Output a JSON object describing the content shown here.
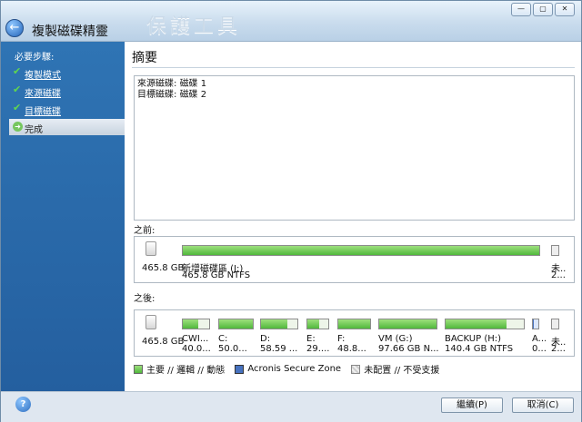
{
  "window": {
    "title": "複製磁碟精靈",
    "background_title": "保護工具",
    "controls": [
      "—",
      "▢",
      "✕"
    ]
  },
  "sidebar": {
    "heading": "必要步驟:",
    "steps": [
      {
        "label": "複製模式",
        "icon": "check-icon",
        "active": false
      },
      {
        "label": "來源磁碟",
        "icon": "check-icon",
        "active": false
      },
      {
        "label": "目標磁碟",
        "icon": "check-icon",
        "active": false
      },
      {
        "label": "完成",
        "icon": "arrow-right-icon",
        "active": true
      }
    ]
  },
  "summary": {
    "title": "摘要",
    "source_label": "來源磁碟:",
    "source_value": "磁碟 1",
    "target_label": "目標磁碟:",
    "target_value": "磁碟 2"
  },
  "before": {
    "label": "之前:",
    "disk_size": "465.8 GB",
    "partitions": [
      {
        "name": "新增磁碟區 (J:)",
        "detail": "465.8 GB  NTFS",
        "fill": 1.0
      },
      {
        "name": "未...",
        "detail": "2...",
        "fill": 0
      }
    ]
  },
  "after": {
    "label": "之後:",
    "disk_size": "465.8 GB",
    "partitions": [
      {
        "name": "CWI...",
        "detail": "40.0...",
        "fill": 0.58
      },
      {
        "name": "C:",
        "detail": "50.0...",
        "fill": 1.0
      },
      {
        "name": "D:",
        "detail": "58.59 ...",
        "fill": 0.72
      },
      {
        "name": "E:",
        "detail": "29....",
        "fill": 0.55
      },
      {
        "name": "F:",
        "detail": "48.8...",
        "fill": 1.0
      },
      {
        "name": "VM (G:)",
        "detail": "97.66 GB  N...",
        "fill": 1.0
      },
      {
        "name": "BACKUP (H:)",
        "detail": "140.4 GB  NTFS",
        "fill": 0.78
      },
      {
        "name": "A...",
        "detail": "0...",
        "fill": 0.2
      },
      {
        "name": "未...",
        "detail": "2...",
        "fill": 0
      }
    ]
  },
  "legend": {
    "primary": "主要 // 邏輯 // 動態",
    "secure": "Acronis Secure Zone",
    "unallocated": "未配置 // 不受支援"
  },
  "footer": {
    "help": "?",
    "continue": "繼續(P)",
    "cancel": "取消(C)"
  }
}
